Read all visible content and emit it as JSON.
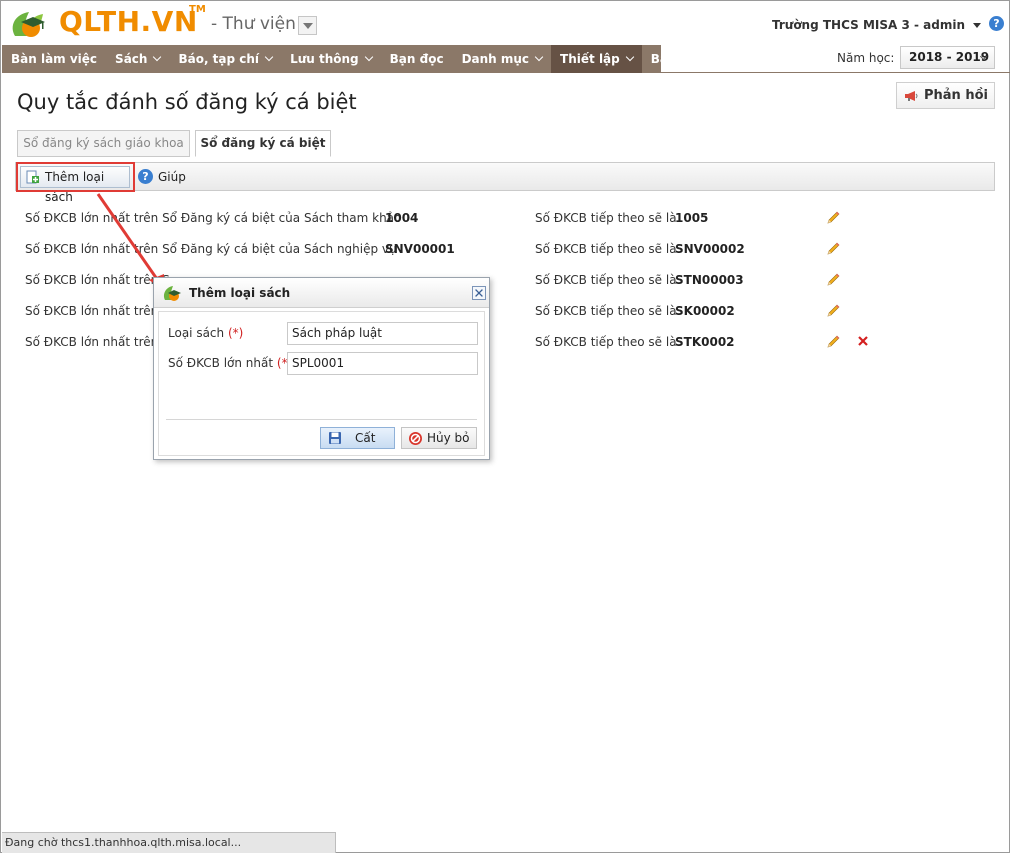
{
  "header": {
    "logo_text": "QLTH.VN",
    "logo_tm": "TM",
    "module": "- Thư viện",
    "user": "Trường THCS MISA 3 - admin",
    "help_symbol": "?"
  },
  "nav": {
    "items": [
      {
        "label": "Bàn làm việc",
        "has_caret": false
      },
      {
        "label": "Sách",
        "has_caret": true
      },
      {
        "label": "Báo, tạp chí",
        "has_caret": true
      },
      {
        "label": "Lưu thông",
        "has_caret": true
      },
      {
        "label": "Bạn đọc",
        "has_caret": false
      },
      {
        "label": "Danh mục",
        "has_caret": true
      },
      {
        "label": "Thiết lập",
        "has_caret": true,
        "active": true
      },
      {
        "label": "Báo cáo",
        "has_caret": false
      }
    ],
    "year_label": "Năm học:",
    "year_value": "2018 - 2019"
  },
  "page": {
    "title": "Quy tắc đánh số đăng ký cá biệt",
    "feedback_label": "Phản hồi"
  },
  "tabs": [
    {
      "label": "Sổ đăng ký sách giáo khoa",
      "active": false
    },
    {
      "label": "Sổ đăng ký cá biệt",
      "active": true
    }
  ],
  "toolbar": {
    "add_label": "Thêm loại sách",
    "help_label": "Giúp"
  },
  "rules": {
    "next_label": "Số ĐKCB tiếp theo sẽ là",
    "rows": [
      {
        "label": "Số ĐKCB lớn nhất trên Sổ Đăng ký cá biệt của Sách tham khảo",
        "max": "1004",
        "next": "1005",
        "deletable": false
      },
      {
        "label": "Số ĐKCB lớn nhất trên Sổ Đăng ký cá biệt của Sách nghiệp vụ",
        "max": "SNV00001",
        "next": "SNV00002",
        "deletable": false
      },
      {
        "label": "Số ĐKCB lớn nhất trên S",
        "max": "",
        "next": "STN00003",
        "deletable": false
      },
      {
        "label": "Số ĐKCB lớn nhất trên S",
        "max": "",
        "next": "SK00002",
        "deletable": false
      },
      {
        "label": "Số ĐKCB lớn nhất trên S",
        "max": "",
        "next": "STK0002",
        "deletable": true
      }
    ]
  },
  "dialog": {
    "title": "Thêm loại sách",
    "book_type_label": "Loại sách",
    "book_type_value": "Sách pháp luật",
    "max_label": "Số ĐKCB lớn nhất",
    "max_value": "SPL0001",
    "required_mark": "(*)",
    "save_label": "Cất",
    "cancel_label": "Hủy bỏ"
  },
  "status_bar": {
    "text": "Đang chờ thcs1.thanhhoa.qlth.misa.local..."
  },
  "colors": {
    "nav_bg": "#8b7868",
    "nav_active": "#665245",
    "logo": "#f08c00",
    "highlight": "#e03b35"
  }
}
